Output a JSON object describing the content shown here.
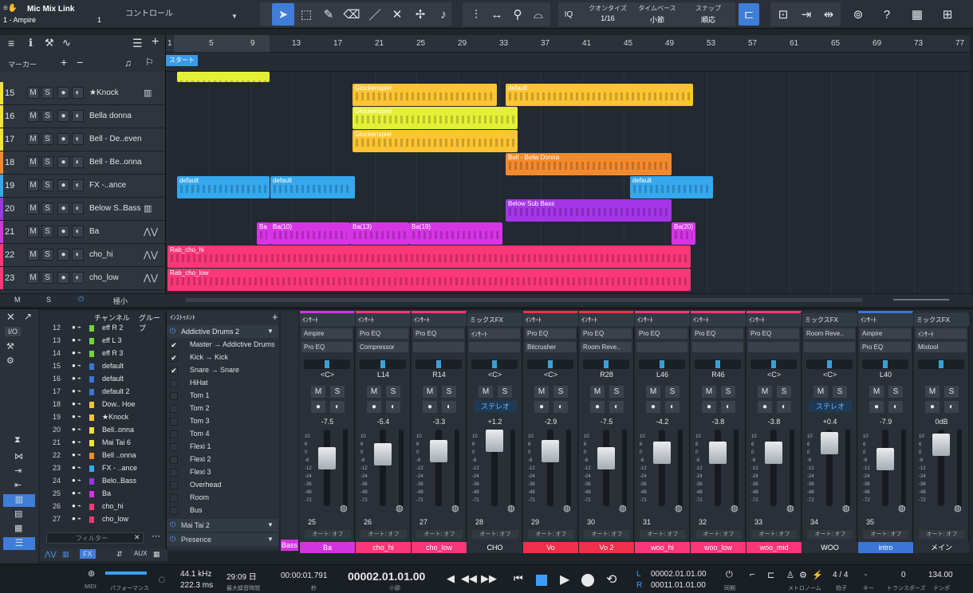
{
  "app": {
    "song_title": "Mic Mix Link",
    "track_selector": "1 - Ampire",
    "track_selector_suffix": "1",
    "control_label": "コントロール"
  },
  "toolbar": {
    "quantize_label": "クオンタイズ",
    "quantize_value": "1/16",
    "timebase_label": "タイムベース",
    "timebase_value": "小節",
    "snap_label": "スナップ",
    "snap_value": "順応",
    "iq_label": "IQ"
  },
  "ruler": {
    "bars": [
      "1",
      "5",
      "9",
      "13",
      "17",
      "21",
      "25",
      "29",
      "33",
      "37",
      "41",
      "45",
      "49",
      "53",
      "57",
      "61",
      "65",
      "69",
      "73",
      "77"
    ],
    "marker_label": "マーカー",
    "start_marker": "スタート"
  },
  "tracks": [
    {
      "num": "15",
      "name": "★Knock",
      "color": "#f2e33a",
      "icon": "keys-icon"
    },
    {
      "num": "16",
      "name": "Bella donna",
      "color": "#f2e33a",
      "icon": "none"
    },
    {
      "num": "17",
      "name": "Bell - De..even",
      "color": "#f2e33a",
      "icon": "none"
    },
    {
      "num": "18",
      "name": "Bell - Be..onna",
      "color": "#f58a2c",
      "icon": "none"
    },
    {
      "num": "19",
      "name": "FX -..ance",
      "color": "#35a8ee",
      "icon": "none"
    },
    {
      "num": "20",
      "name": "Below S..Bass",
      "color": "#9a35e8",
      "icon": "keys-icon"
    },
    {
      "num": "21",
      "name": "Ba",
      "color": "#d235e0",
      "icon": "wave-icon"
    },
    {
      "num": "22",
      "name": "cho_hi",
      "color": "#fa3778",
      "icon": "wave-icon"
    },
    {
      "num": "23",
      "name": "cho_low",
      "color": "#fa3778",
      "icon": "wave-icon"
    }
  ],
  "track_buttons": {
    "m": "M",
    "s": "S"
  },
  "clips": [
    {
      "name": "",
      "track": -1,
      "color": "#e4f036"
    },
    {
      "name": "Glockenspiel",
      "track": 0,
      "color": "#fbc432"
    },
    {
      "name": "default",
      "track": 0,
      "color": "#fbc432"
    },
    {
      "name": "Glockenspiel",
      "track": 1,
      "color": "#e4f036"
    },
    {
      "name": "Glockenspiel",
      "track": 2,
      "color": "#fbc432"
    },
    {
      "name": "Bell - Bella Donna",
      "track": 3,
      "color": "#f58a2c"
    },
    {
      "name": "default",
      "track": 4,
      "color": "#35a8ee"
    },
    {
      "name": "default",
      "track": 4,
      "color": "#35a8ee"
    },
    {
      "name": "default",
      "track": 4,
      "color": "#35a8ee"
    },
    {
      "name": "Below Sub Bass",
      "track": 5,
      "color": "#a635e8"
    },
    {
      "name": "Ba",
      "track": 6,
      "color": "#d635e6"
    },
    {
      "name": "Ba(10)",
      "track": 6,
      "color": "#d635e6"
    },
    {
      "name": "Ba(13)",
      "track": 6,
      "color": "#d635e6"
    },
    {
      "name": "Ba(19)",
      "track": 6,
      "color": "#d635e6"
    },
    {
      "name": "Ba(20)",
      "track": 6,
      "color": "#d635e6"
    },
    {
      "name": "Rab_cho_hi",
      "track": 7,
      "color": "#fa3778"
    },
    {
      "name": "Rab_cho_low",
      "track": 8,
      "color": "#fa3778"
    }
  ],
  "bottom_strip": {
    "m": "M",
    "s": "S",
    "size": "極小"
  },
  "mixer": {
    "channel_header": "チャンネル",
    "group_header": "グループ",
    "instrument_header": "ｲﾝｽﾄｩﾒﾝﾄ",
    "io_label": "I/O",
    "filter_placeholder": "フィルター",
    "aux_label": "AUX",
    "fx_label": "FX",
    "channels": [
      {
        "n": "12",
        "name": "eff R 2",
        "color": "#74d43a"
      },
      {
        "n": "13",
        "name": "eff L 3",
        "color": "#74d43a"
      },
      {
        "n": "14",
        "name": "eff R 3",
        "color": "#74d43a"
      },
      {
        "n": "15",
        "name": "default",
        "color": "#3a76d6"
      },
      {
        "n": "16",
        "name": "default",
        "color": "#3a76d6"
      },
      {
        "n": "17",
        "name": "default 2",
        "color": "#3a76d6"
      },
      {
        "n": "18",
        "name": "Dow.. Hoe",
        "color": "#fbc432"
      },
      {
        "n": "19",
        "name": "★Knock",
        "color": "#fbc432"
      },
      {
        "n": "20",
        "name": "Bell..onna",
        "color": "#f2e33a"
      },
      {
        "n": "21",
        "name": "Mai Tai 6",
        "color": "#f2e33a"
      },
      {
        "n": "22",
        "name": "Bell ..onna",
        "color": "#f58a2c"
      },
      {
        "n": "23",
        "name": "FX - ..ance",
        "color": "#35a8ee"
      },
      {
        "n": "24",
        "name": "Belo..Bass",
        "color": "#9a35e8"
      },
      {
        "n": "25",
        "name": "Ba",
        "color": "#d235e0"
      },
      {
        "n": "26",
        "name": "cho_hi",
        "color": "#fa3778"
      },
      {
        "n": "27",
        "name": "cho_low",
        "color": "#fa3778"
      }
    ],
    "instrument_title": "Addictive Drums 2",
    "instrument_items": [
      {
        "label": "Master → Addictive Drums",
        "checked": "✔"
      },
      {
        "label": "Kick → Kick",
        "checked": "✔"
      },
      {
        "label": "Snare → Snare",
        "checked": "✔"
      },
      {
        "label": "HiHat",
        "checked": ""
      },
      {
        "label": "Tom 1",
        "checked": ""
      },
      {
        "label": "Tom 2",
        "checked": ""
      },
      {
        "label": "Tom 3",
        "checked": ""
      },
      {
        "label": "Tom 4",
        "checked": ""
      },
      {
        "label": "Flexi 1",
        "checked": ""
      },
      {
        "label": "Flexi 2",
        "checked": ""
      },
      {
        "label": "Flexi 3",
        "checked": ""
      },
      {
        "label": "Overhead",
        "checked": ""
      },
      {
        "label": "Room",
        "checked": ""
      },
      {
        "label": "Bus",
        "checked": ""
      }
    ],
    "instrument2": "Mai Tai 2",
    "instrument3": "Presence",
    "strips": [
      {
        "header": "ｲﾝｻｰﾄ",
        "slot1": "Ampire",
        "slot2": "Pro EQ",
        "pan": "<C>",
        "vol": "-7.5",
        "num": "25",
        "label": "Ba",
        "color": "#d235e0",
        "fader": 0.62,
        "stereo": ""
      },
      {
        "header": "ｲﾝｻｰﾄ",
        "slot1": "Pro EQ",
        "slot2": "Compressor",
        "pan": "L14",
        "vol": "-5.4",
        "num": "26",
        "label": "cho_hi",
        "color": "#fa3778",
        "fader": 0.68,
        "stereo": ""
      },
      {
        "header": "ｲﾝｻｰﾄ",
        "slot1": "Pro EQ",
        "slot2": "",
        "pan": "R14",
        "vol": "-3.3",
        "num": "27",
        "label": "cho_low",
        "color": "#fa3778",
        "fader": 0.72,
        "stereo": ""
      },
      {
        "header": "ミックスFX",
        "slot1": "ｲﾝｻｰﾄ",
        "slot2": "",
        "pan": "<C>",
        "vol": "+1.2",
        "num": "28",
        "label": "CHO",
        "color": "#2a3037",
        "fader": 0.85,
        "stereo": "ステレオ"
      },
      {
        "header": "ｲﾝｻｰﾄ",
        "slot1": "Pro EQ",
        "slot2": "Bitcrusher",
        "pan": "<C>",
        "vol": "-2.9",
        "num": "29",
        "label": "Vo",
        "color": "#f0304a",
        "fader": 0.72,
        "stereo": ""
      },
      {
        "header": "ｲﾝｻｰﾄ",
        "slot1": "Pro EQ",
        "slot2": "Room Reve..",
        "pan": "R28",
        "vol": "-7.5",
        "num": "30",
        "label": "Vo 2",
        "color": "#f0304a",
        "fader": 0.62,
        "stereo": ""
      },
      {
        "header": "ｲﾝｻｰﾄ",
        "slot1": "Pro EQ",
        "slot2": "",
        "pan": "L46",
        "vol": "-4.2",
        "num": "31",
        "label": "woo_hi",
        "color": "#fa3778",
        "fader": 0.7,
        "stereo": ""
      },
      {
        "header": "ｲﾝｻｰﾄ",
        "slot1": "Pro EQ",
        "slot2": "",
        "pan": "R46",
        "vol": "-3.8",
        "num": "32",
        "label": "woo_low",
        "color": "#fa3778",
        "fader": 0.7,
        "stereo": ""
      },
      {
        "header": "ｲﾝｻｰﾄ",
        "slot1": "Pro EQ",
        "slot2": "",
        "pan": "<C>",
        "vol": "-3.8",
        "num": "33",
        "label": "woo_mid",
        "color": "#fa3778",
        "fader": 0.7,
        "stereo": ""
      },
      {
        "header": "ミックスFX",
        "slot1": "Room Reve..",
        "slot2": "",
        "pan": "<C>",
        "vol": "+0.4",
        "num": "34",
        "label": "WOO",
        "color": "#2a3037",
        "fader": 0.82,
        "stereo": "ステレオ"
      },
      {
        "header": "ｲﾝｻｰﾄ",
        "slot1": "Ampire",
        "slot2": "Pro EQ",
        "pan": "L40",
        "vol": "-7.9",
        "num": "35",
        "label": "intro",
        "color": "#3a76d6",
        "fader": 0.61,
        "stereo": ""
      },
      {
        "header": "ミックスFX",
        "slot1": "ｲﾝｻｰﾄ",
        "slot2": "Mixtool",
        "pan": "",
        "vol": "0dB",
        "num": "",
        "label": "メイン",
        "color": "#2a3037",
        "fader": 0.8,
        "stereo": ""
      }
    ],
    "partial_strip_label": "Bass",
    "auto_label": "オート: オフ",
    "ms": {
      "m": "M",
      "s": "S"
    }
  },
  "transport": {
    "midi_label": "MIDI",
    "perf_label": "パフォーマンス",
    "sample_rate": "44.1 kHz",
    "latency": "222.3 ms",
    "record_time": "29:09 日",
    "record_label": "最大録音時間",
    "time_seconds": "00:00:01.791",
    "time_seconds_label": "秒",
    "position": "00002.01.01.00",
    "position_label": "小節",
    "loop_l": "00002.01.01.00",
    "loop_r": "00011.01.01.00",
    "l": "L",
    "r": "R",
    "sync_label": "同期",
    "metronome_label": "メトロノーム",
    "signature": "4 / 4",
    "signature_label": "拍子",
    "key_label": "キー",
    "transpose": "0",
    "transpose_label": "トランスポーズ",
    "tempo": "134.00",
    "tempo_label": "テンポ"
  }
}
